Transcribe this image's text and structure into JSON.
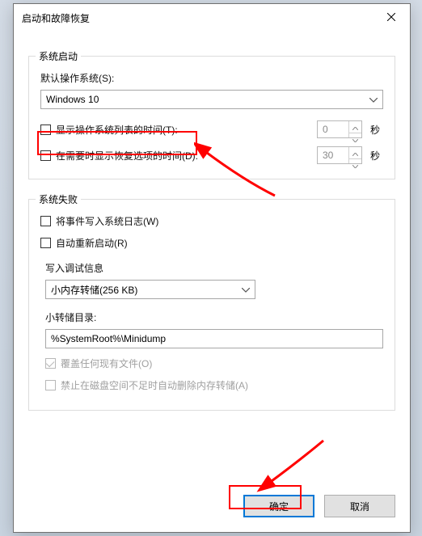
{
  "dialog": {
    "title": "启动和故障恢复"
  },
  "system_start": {
    "group_title": "系统启动",
    "default_os_label": "默认操作系统(S):",
    "default_os_value": "Windows 10",
    "show_list_label": "显示操作系统列表的时间(T):",
    "show_list_value": "0",
    "show_list_unit": "秒",
    "show_recovery_label": "在需要时显示恢复选项的时间(D):",
    "show_recovery_value": "30",
    "show_recovery_unit": "秒"
  },
  "system_fail": {
    "group_title": "系统失败",
    "write_event_label": "将事件写入系统日志(W)",
    "auto_restart_label": "自动重新启动(R)",
    "debug_info_label": "写入调试信息",
    "dump_type_value": "小内存转储(256 KB)",
    "dump_dir_label": "小转储目录:",
    "dump_dir_value": "%SystemRoot%\\Minidump",
    "overwrite_label": "覆盖任何现有文件(O)",
    "disable_auto_del_label": "禁止在磁盘空间不足时自动删除内存转储(A)"
  },
  "buttons": {
    "ok": "确定",
    "cancel": "取消"
  },
  "annotations": {
    "highlight_color": "#ff0000"
  }
}
